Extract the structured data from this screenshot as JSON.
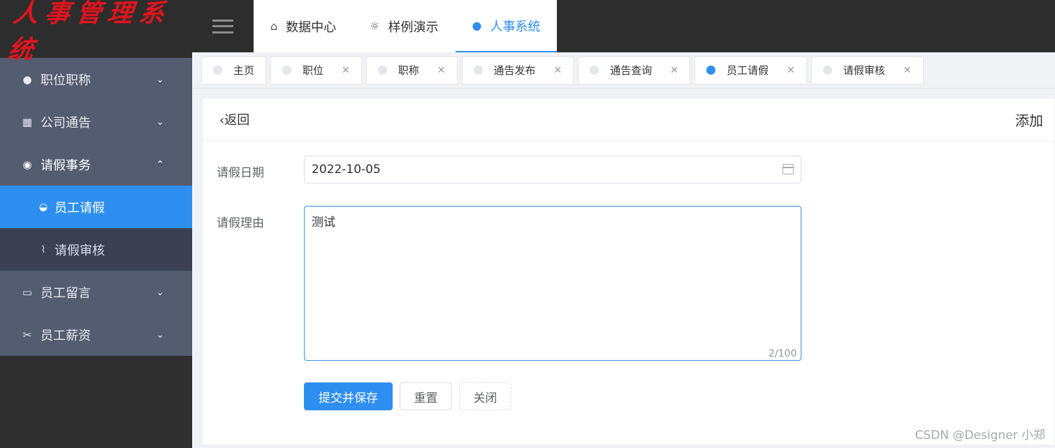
{
  "app": {
    "logo_text": "人事管理系统"
  },
  "sidebar": {
    "items": [
      {
        "label": "职位职称",
        "icon": "info-circle-icon",
        "glyph": "●",
        "chevron": "⌄"
      },
      {
        "label": "公司通告",
        "icon": "grid-icon",
        "glyph": "▦",
        "chevron": "⌄"
      },
      {
        "label": "请假事务",
        "icon": "globe-icon",
        "glyph": "◉",
        "chevron": "⌃",
        "children": [
          {
            "label": "员工请假",
            "icon": "circle-arrow-icon",
            "glyph": "◒",
            "active": true
          },
          {
            "label": "请假审核",
            "icon": "paperclip-icon",
            "glyph": "⌇",
            "active": false
          }
        ]
      },
      {
        "label": "员工留言",
        "icon": "window-icon",
        "glyph": "▭",
        "chevron": "⌄"
      },
      {
        "label": "员工薪资",
        "icon": "tools-icon",
        "glyph": "✂",
        "chevron": "⌄"
      }
    ]
  },
  "topnav": {
    "tabs": [
      {
        "label": "数据中心",
        "glyph": "⌂",
        "icon": "home-icon"
      },
      {
        "label": "样例演示",
        "glyph": "☼",
        "icon": "lightbulb-icon"
      },
      {
        "label": "人事系统",
        "glyph": "●",
        "icon": "info-icon",
        "active": true
      }
    ]
  },
  "tags": [
    {
      "label": "主页",
      "closable": false
    },
    {
      "label": "职位",
      "closable": true
    },
    {
      "label": "职称",
      "closable": true
    },
    {
      "label": "通告发布",
      "closable": true
    },
    {
      "label": "通告查询",
      "closable": true
    },
    {
      "label": "员工请假",
      "closable": true,
      "active": true
    },
    {
      "label": "请假审核",
      "closable": true
    }
  ],
  "page": {
    "back_label": "返回",
    "back_glyph": "‹",
    "title": "添加",
    "date_label": "请假日期",
    "date_value": "2022-10-05",
    "reason_label": "请假理由",
    "reason_value": "测试",
    "reason_counter": "2/100",
    "submit_label": "提交并保存",
    "reset_label": "重置",
    "close_label": "关闭"
  },
  "watermark": "CSDN @Designer 小郑",
  "colors": {
    "accent": "#2f8ff0",
    "sidebar_bg": "#545c70",
    "topbar_bg": "#2d2d2d",
    "logo": "#e0141e"
  }
}
